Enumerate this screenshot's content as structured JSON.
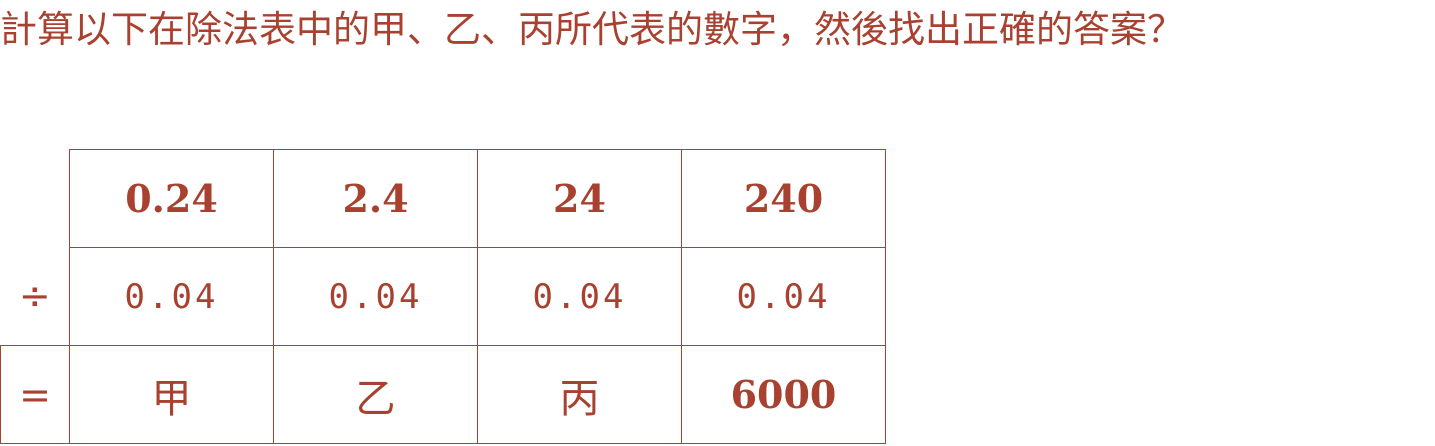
{
  "question": "計算以下在除法表中的甲、乙、丙所代表的數字，然後找出正確的答案？",
  "table": {
    "dividends": [
      "0.24",
      "2.4",
      "24",
      "240"
    ],
    "divide_symbol": "÷",
    "divisors": [
      "0.04",
      "0.04",
      "0.04",
      "0.04"
    ],
    "equals_symbol": "=",
    "results": [
      "甲",
      "乙",
      "丙",
      "6000"
    ]
  }
}
